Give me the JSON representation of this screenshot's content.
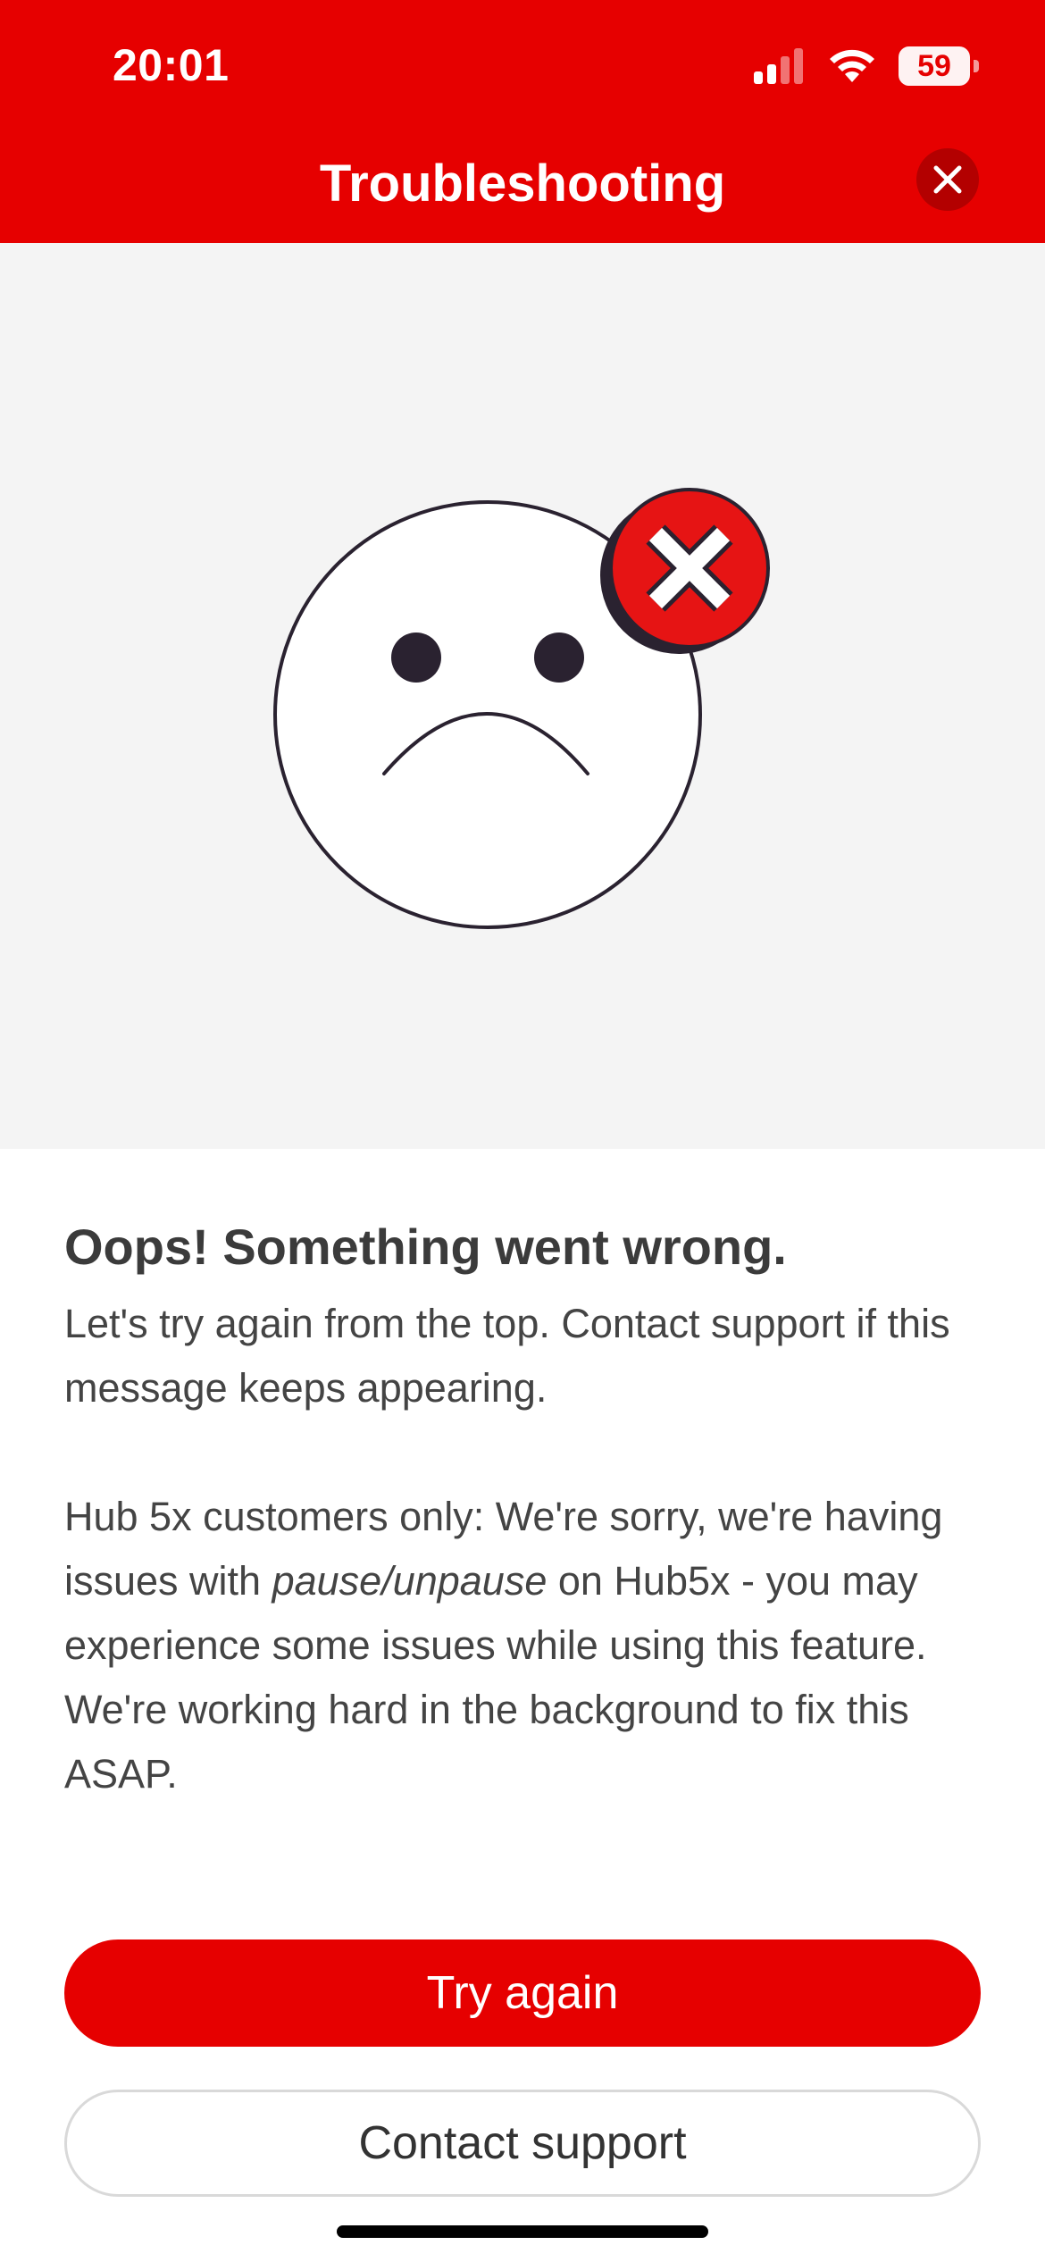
{
  "status_bar": {
    "time": "20:01",
    "battery": "59"
  },
  "header": {
    "title": "Troubleshooting"
  },
  "message": {
    "title": "Oops! Something went wrong.",
    "line1": "Let's try again from the top. Contact support if this message keeps appearing.",
    "hub_notice_prefix": "Hub 5x customers only: We're sorry, we're having issues with ",
    "hub_notice_emphasis": "pause/unpause",
    "hub_notice_suffix": " on Hub5x - you may experience some issues while using this feature.",
    "line_final": "We're working hard in the background to fix this ASAP."
  },
  "buttons": {
    "primary": "Try again",
    "secondary": "Contact support"
  },
  "colors": {
    "brand_red": "#e60000",
    "illustration_bg": "#f4f4f4"
  },
  "icons": [
    "cellular-signal-icon",
    "wifi-icon",
    "battery-icon",
    "close-icon",
    "sad-face-icon",
    "error-x-icon"
  ]
}
